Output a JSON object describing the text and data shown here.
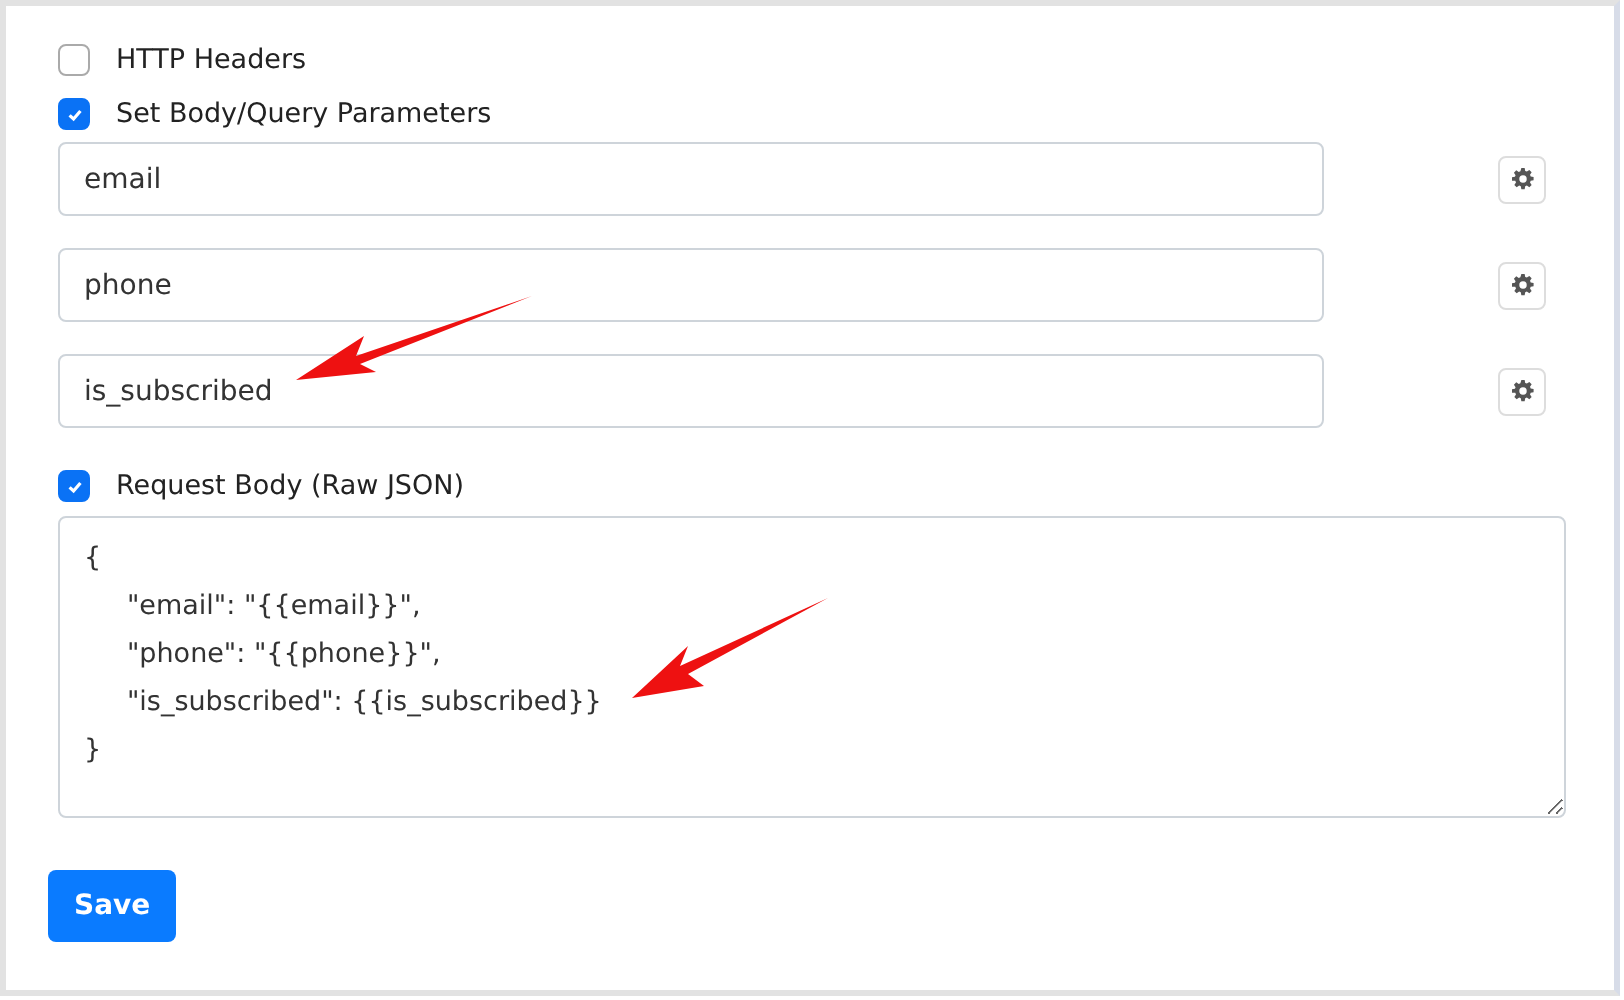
{
  "options": [
    {
      "label": "HTTP Headers",
      "checked": false
    },
    {
      "label": "Set Body/Query Parameters",
      "checked": true
    }
  ],
  "parameters": [
    {
      "value": "email"
    },
    {
      "value": "phone"
    },
    {
      "value": "is_subscribed"
    }
  ],
  "request_body": {
    "label": "Request Body (Raw JSON)",
    "checked": true,
    "value": "{\n\t\"email\": \"{{email}}\",\n\t\"phone\": \"{{phone}}\",\n\t\"is_subscribed\": {{is_subscribed}}\n}"
  },
  "buttons": [
    {
      "label": "Save"
    }
  ]
}
